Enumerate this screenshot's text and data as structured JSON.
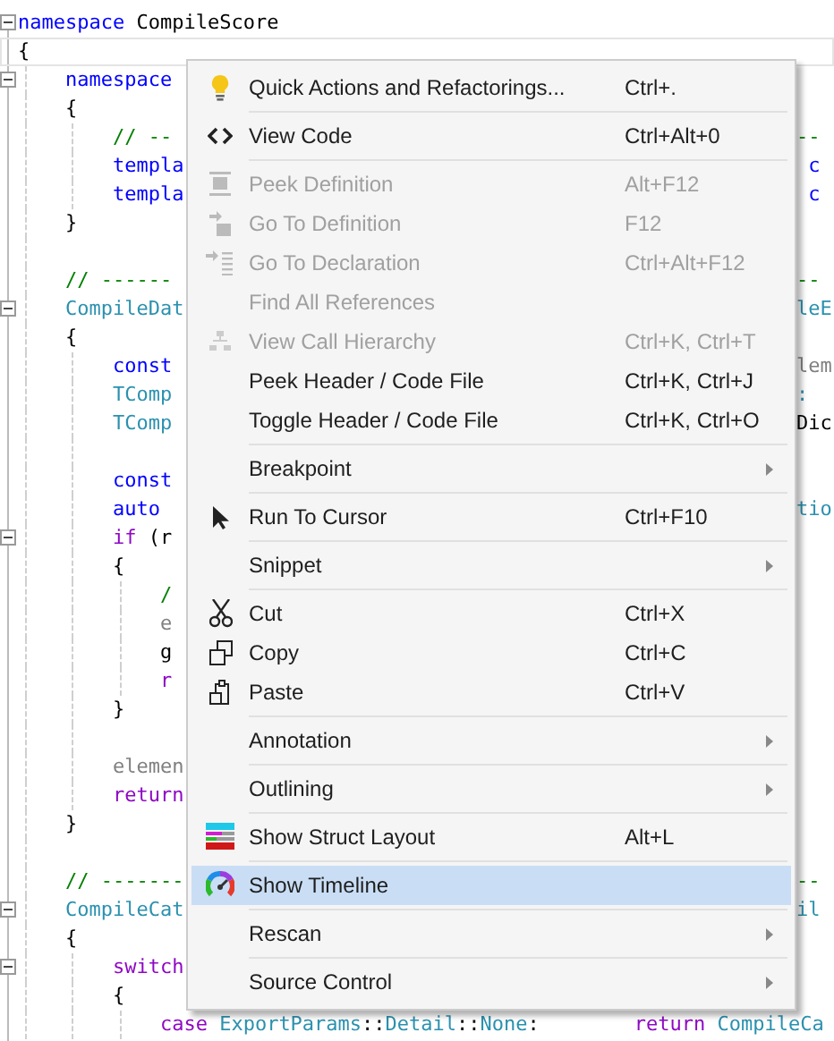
{
  "editor": {
    "lines": [
      {
        "fold": true,
        "current": false,
        "tokens": [
          {
            "text": "namespace",
            "kind": "kw"
          },
          {
            "text": " CompileScore",
            "kind": "plain"
          }
        ]
      },
      {
        "fold": false,
        "current": true,
        "tokens": [
          {
            "text": "{",
            "kind": "plain"
          }
        ]
      },
      {
        "fold": true,
        "current": false,
        "tokens": [
          {
            "text": "    namespace",
            "kind": "kw"
          }
        ]
      },
      {
        "fold": false,
        "current": false,
        "tokens": [
          {
            "text": "    {",
            "kind": "plain"
          }
        ]
      },
      {
        "fold": false,
        "current": false,
        "tokens": [
          {
            "text": "        // --",
            "kind": "cmt"
          }
        ],
        "right": [
          {
            "text": "--",
            "kind": "cmt"
          }
        ]
      },
      {
        "fold": false,
        "current": false,
        "tokens": [
          {
            "text": "        templa",
            "kind": "kw"
          }
        ],
        "right": [
          {
            "text": " c",
            "kind": "kw"
          }
        ]
      },
      {
        "fold": false,
        "current": false,
        "tokens": [
          {
            "text": "        templa",
            "kind": "kw"
          }
        ],
        "right": [
          {
            "text": " c",
            "kind": "kw"
          }
        ]
      },
      {
        "fold": false,
        "current": false,
        "tokens": [
          {
            "text": "    }",
            "kind": "plain"
          }
        ]
      },
      {
        "fold": false,
        "current": false
      },
      {
        "fold": false,
        "current": false,
        "tokens": [
          {
            "text": "    // ------",
            "kind": "cmt"
          }
        ],
        "right": [
          {
            "text": "--",
            "kind": "cmt"
          }
        ]
      },
      {
        "fold": true,
        "current": false,
        "tokens": [
          {
            "text": "    CompileDat",
            "kind": "type"
          }
        ],
        "right": [
          {
            "text": "leE",
            "kind": "type"
          }
        ]
      },
      {
        "fold": false,
        "current": false,
        "tokens": [
          {
            "text": "    {",
            "kind": "plain"
          }
        ]
      },
      {
        "fold": false,
        "current": false,
        "tokens": [
          {
            "text": "        const",
            "kind": "kw"
          }
        ],
        "right": [
          {
            "text": "lem",
            "kind": "var"
          }
        ]
      },
      {
        "fold": false,
        "current": false,
        "tokens": [
          {
            "text": "        TComp",
            "kind": "type"
          }
        ],
        "right": [
          {
            "text": ":",
            "kind": "type"
          }
        ]
      },
      {
        "fold": false,
        "current": false,
        "tokens": [
          {
            "text": "        TComp",
            "kind": "type"
          }
        ],
        "right": [
          {
            "text": "Dic",
            "kind": "plain"
          }
        ]
      },
      {
        "fold": false,
        "current": false
      },
      {
        "fold": false,
        "current": false,
        "tokens": [
          {
            "text": "        const",
            "kind": "kw"
          }
        ]
      },
      {
        "fold": false,
        "current": false,
        "tokens": [
          {
            "text": "        auto",
            "kind": "kw"
          }
        ],
        "right": [
          {
            "text": "tio",
            "kind": "type"
          }
        ]
      },
      {
        "fold": true,
        "current": false,
        "tokens": [
          {
            "text": "        if",
            "kind": "ctl"
          },
          {
            "text": " (r",
            "kind": "plain"
          }
        ]
      },
      {
        "fold": false,
        "current": false,
        "tokens": [
          {
            "text": "        {",
            "kind": "plain"
          }
        ]
      },
      {
        "fold": false,
        "current": false,
        "tokens": [
          {
            "text": "            /",
            "kind": "cmt"
          }
        ]
      },
      {
        "fold": false,
        "current": false,
        "tokens": [
          {
            "text": "            e",
            "kind": "var"
          }
        ]
      },
      {
        "fold": false,
        "current": false,
        "tokens": [
          {
            "text": "            g",
            "kind": "plain"
          }
        ]
      },
      {
        "fold": false,
        "current": false,
        "tokens": [
          {
            "text": "            r",
            "kind": "ctl"
          }
        ]
      },
      {
        "fold": false,
        "current": false,
        "tokens": [
          {
            "text": "        }",
            "kind": "plain"
          }
        ]
      },
      {
        "fold": false,
        "current": false
      },
      {
        "fold": false,
        "current": false,
        "tokens": [
          {
            "text": "        elemen",
            "kind": "var"
          }
        ]
      },
      {
        "fold": false,
        "current": false,
        "tokens": [
          {
            "text": "        return",
            "kind": "ctl"
          }
        ]
      },
      {
        "fold": false,
        "current": false,
        "tokens": [
          {
            "text": "    }",
            "kind": "plain"
          }
        ]
      },
      {
        "fold": false,
        "current": false
      },
      {
        "fold": false,
        "current": false,
        "tokens": [
          {
            "text": "    // -------",
            "kind": "cmt"
          }
        ],
        "right": [
          {
            "text": "--",
            "kind": "cmt"
          }
        ]
      },
      {
        "fold": true,
        "current": false,
        "tokens": [
          {
            "text": "    CompileCat",
            "kind": "type"
          }
        ],
        "right": [
          {
            "text": "il",
            "kind": "type"
          }
        ]
      },
      {
        "fold": false,
        "current": false,
        "tokens": [
          {
            "text": "    {",
            "kind": "plain"
          }
        ]
      },
      {
        "fold": true,
        "current": false,
        "tokens": [
          {
            "text": "        switch",
            "kind": "ctl"
          }
        ]
      },
      {
        "fold": false,
        "current": false,
        "tokens": [
          {
            "text": "        {",
            "kind": "plain"
          }
        ]
      },
      {
        "fold": false,
        "current": false,
        "tokens": [
          {
            "text": "            case",
            "kind": "ctl"
          },
          {
            "text": " ExportParams",
            "kind": "type"
          },
          {
            "text": "::",
            "kind": "plain"
          },
          {
            "text": "Detail",
            "kind": "type"
          },
          {
            "text": "::",
            "kind": "plain"
          },
          {
            "text": "None",
            "kind": "type"
          },
          {
            "text": ":        ",
            "kind": "plain"
          },
          {
            "text": "return",
            "kind": "ctl"
          },
          {
            "text": " CompileCa",
            "kind": "type"
          }
        ]
      }
    ]
  },
  "context_menu": {
    "items": [
      {
        "kind": "item",
        "label": "Quick Actions and Refactorings...",
        "shortcut": "Ctrl+.",
        "disabled": false,
        "selected": false,
        "submenu": false
      },
      {
        "kind": "separator"
      },
      {
        "kind": "item",
        "label": "View Code",
        "shortcut": "Ctrl+Alt+0",
        "disabled": false,
        "selected": false,
        "submenu": false
      },
      {
        "kind": "separator"
      },
      {
        "kind": "item",
        "label": "Peek Definition",
        "shortcut": "Alt+F12",
        "disabled": true,
        "selected": false,
        "submenu": false
      },
      {
        "kind": "item",
        "label": "Go To Definition",
        "shortcut": "F12",
        "disabled": true,
        "selected": false,
        "submenu": false
      },
      {
        "kind": "item",
        "label": "Go To Declaration",
        "shortcut": "Ctrl+Alt+F12",
        "disabled": true,
        "selected": false,
        "submenu": false
      },
      {
        "kind": "item",
        "label": "Find All References",
        "disabled": true,
        "selected": false,
        "submenu": false
      },
      {
        "kind": "item",
        "label": "View Call Hierarchy",
        "shortcut": "Ctrl+K, Ctrl+T",
        "disabled": true,
        "selected": false,
        "submenu": false
      },
      {
        "kind": "item",
        "label": "Peek Header / Code File",
        "shortcut": "Ctrl+K, Ctrl+J",
        "disabled": false,
        "selected": false,
        "submenu": false
      },
      {
        "kind": "item",
        "label": "Toggle Header / Code File",
        "shortcut": "Ctrl+K, Ctrl+O",
        "disabled": false,
        "selected": false,
        "submenu": false
      },
      {
        "kind": "separator"
      },
      {
        "kind": "item",
        "label": "Breakpoint",
        "disabled": false,
        "selected": false,
        "submenu": true
      },
      {
        "kind": "separator"
      },
      {
        "kind": "item",
        "label": "Run To Cursor",
        "shortcut": "Ctrl+F10",
        "disabled": false,
        "selected": false,
        "submenu": false
      },
      {
        "kind": "separator"
      },
      {
        "kind": "item",
        "label": "Snippet",
        "disabled": false,
        "selected": false,
        "submenu": true
      },
      {
        "kind": "separator"
      },
      {
        "kind": "item",
        "label": "Cut",
        "shortcut": "Ctrl+X",
        "disabled": false,
        "selected": false,
        "submenu": false
      },
      {
        "kind": "item",
        "label": "Copy",
        "shortcut": "Ctrl+C",
        "disabled": false,
        "selected": false,
        "submenu": false
      },
      {
        "kind": "item",
        "label": "Paste",
        "shortcut": "Ctrl+V",
        "disabled": false,
        "selected": false,
        "submenu": false
      },
      {
        "kind": "separator"
      },
      {
        "kind": "item",
        "label": "Annotation",
        "disabled": false,
        "selected": false,
        "submenu": true
      },
      {
        "kind": "separator"
      },
      {
        "kind": "item",
        "label": "Outlining",
        "disabled": false,
        "selected": false,
        "submenu": true
      },
      {
        "kind": "separator"
      },
      {
        "kind": "item",
        "label": "Show Struct Layout",
        "shortcut": "Alt+L",
        "disabled": false,
        "selected": false,
        "submenu": false
      },
      {
        "kind": "separator"
      },
      {
        "kind": "item",
        "label": "Show Timeline",
        "disabled": false,
        "selected": true,
        "submenu": false
      },
      {
        "kind": "separator"
      },
      {
        "kind": "item",
        "label": "Rescan",
        "disabled": false,
        "selected": false,
        "submenu": true
      },
      {
        "kind": "separator"
      },
      {
        "kind": "item",
        "label": "Source Control",
        "disabled": false,
        "selected": false,
        "submenu": true
      }
    ]
  }
}
